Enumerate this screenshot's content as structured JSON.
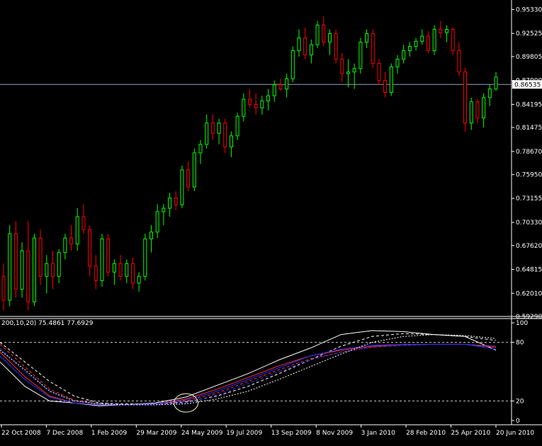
{
  "indicator_label": "200,10,20) 75.4861 77.6929",
  "chart_data": [
    {
      "type": "candlestick",
      "title": "",
      "background": "#000000",
      "up_color": "#00ff00",
      "down_color": "#ff0000",
      "ylim": [
        0.5929,
        0.9645
      ],
      "y_ticks": [
        "0.95330",
        "0.92525",
        "0.89805",
        "0.87000",
        "0.84195",
        "0.81475",
        "0.78670",
        "0.75950",
        "0.73155",
        "0.70330",
        "0.67620",
        "0.64815",
        "0.62010",
        "0.59290"
      ],
      "current_price": 0.86535,
      "current_price_label": "0.86535",
      "candles": [
        [
          0.64,
          0.655,
          0.6,
          0.612
        ],
        [
          0.612,
          0.7,
          0.605,
          0.69
        ],
        [
          0.69,
          0.705,
          0.615,
          0.625
        ],
        [
          0.625,
          0.68,
          0.615,
          0.67
        ],
        [
          0.67,
          0.705,
          0.6,
          0.61
        ],
        [
          0.61,
          0.69,
          0.605,
          0.685
        ],
        [
          0.685,
          0.695,
          0.63,
          0.64
        ],
        [
          0.64,
          0.665,
          0.62,
          0.655
        ],
        [
          0.655,
          0.67,
          0.625,
          0.64
        ],
        [
          0.64,
          0.672,
          0.632,
          0.668
        ],
        [
          0.668,
          0.69,
          0.66,
          0.685
        ],
        [
          0.685,
          0.7,
          0.67,
          0.678
        ],
        [
          0.678,
          0.72,
          0.67,
          0.71
        ],
        [
          0.71,
          0.725,
          0.69,
          0.695
        ],
        [
          0.695,
          0.7,
          0.64,
          0.652
        ],
        [
          0.652,
          0.665,
          0.625,
          0.635
        ],
        [
          0.635,
          0.69,
          0.628,
          0.684
        ],
        [
          0.684,
          0.69,
          0.64,
          0.645
        ],
        [
          0.645,
          0.66,
          0.63,
          0.655
        ],
        [
          0.655,
          0.665,
          0.635,
          0.64
        ],
        [
          0.64,
          0.66,
          0.632,
          0.655
        ],
        [
          0.655,
          0.662,
          0.625,
          0.632
        ],
        [
          0.632,
          0.645,
          0.622,
          0.64
        ],
        [
          0.64,
          0.69,
          0.635,
          0.684
        ],
        [
          0.684,
          0.7,
          0.668,
          0.692
        ],
        [
          0.692,
          0.725,
          0.685,
          0.716
        ],
        [
          0.716,
          0.725,
          0.7,
          0.72
        ],
        [
          0.72,
          0.738,
          0.71,
          0.732
        ],
        [
          0.732,
          0.74,
          0.718,
          0.724
        ],
        [
          0.724,
          0.77,
          0.72,
          0.765
        ],
        [
          0.765,
          0.775,
          0.74,
          0.745
        ],
        [
          0.745,
          0.79,
          0.74,
          0.785
        ],
        [
          0.785,
          0.8,
          0.772,
          0.795
        ],
        [
          0.795,
          0.83,
          0.79,
          0.82
        ],
        [
          0.82,
          0.83,
          0.8,
          0.808
        ],
        [
          0.808,
          0.825,
          0.795,
          0.82
        ],
        [
          0.82,
          0.825,
          0.785,
          0.792
        ],
        [
          0.792,
          0.81,
          0.78,
          0.805
        ],
        [
          0.805,
          0.832,
          0.8,
          0.828
        ],
        [
          0.828,
          0.855,
          0.822,
          0.848
        ],
        [
          0.848,
          0.86,
          0.838,
          0.842
        ],
        [
          0.842,
          0.855,
          0.83,
          0.838
        ],
        [
          0.838,
          0.852,
          0.83,
          0.846
        ],
        [
          0.846,
          0.86,
          0.835,
          0.852
        ],
        [
          0.852,
          0.87,
          0.845,
          0.865
        ],
        [
          0.865,
          0.872,
          0.858,
          0.86
        ],
        [
          0.86,
          0.878,
          0.85,
          0.872
        ],
        [
          0.872,
          0.91,
          0.868,
          0.905
        ],
        [
          0.905,
          0.93,
          0.898,
          0.92
        ],
        [
          0.92,
          0.932,
          0.895,
          0.9
        ],
        [
          0.9,
          0.918,
          0.89,
          0.912
        ],
        [
          0.912,
          0.94,
          0.908,
          0.935
        ],
        [
          0.935,
          0.945,
          0.91,
          0.915
        ],
        [
          0.915,
          0.93,
          0.9,
          0.925
        ],
        [
          0.925,
          0.93,
          0.89,
          0.895
        ],
        [
          0.895,
          0.902,
          0.868,
          0.878
        ],
        [
          0.878,
          0.895,
          0.862,
          0.88
        ],
        [
          0.88,
          0.89,
          0.86,
          0.884
        ],
        [
          0.884,
          0.92,
          0.878,
          0.915
        ],
        [
          0.915,
          0.93,
          0.908,
          0.925
        ],
        [
          0.925,
          0.93,
          0.885,
          0.89
        ],
        [
          0.89,
          0.895,
          0.865,
          0.87
        ],
        [
          0.87,
          0.88,
          0.85,
          0.856
        ],
        [
          0.856,
          0.89,
          0.852,
          0.886
        ],
        [
          0.886,
          0.9,
          0.878,
          0.895
        ],
        [
          0.895,
          0.912,
          0.89,
          0.905
        ],
        [
          0.905,
          0.915,
          0.898,
          0.91
        ],
        [
          0.91,
          0.92,
          0.905,
          0.916
        ],
        [
          0.916,
          0.93,
          0.912,
          0.922
        ],
        [
          0.922,
          0.928,
          0.902,
          0.905
        ],
        [
          0.905,
          0.935,
          0.9,
          0.93
        ],
        [
          0.93,
          0.94,
          0.92,
          0.926
        ],
        [
          0.926,
          0.935,
          0.915,
          0.93
        ],
        [
          0.93,
          0.932,
          0.9,
          0.905
        ],
        [
          0.905,
          0.915,
          0.875,
          0.88
        ],
        [
          0.88,
          0.885,
          0.81,
          0.82
        ],
        [
          0.82,
          0.85,
          0.812,
          0.845
        ],
        [
          0.845,
          0.848,
          0.82,
          0.826
        ],
        [
          0.826,
          0.855,
          0.815,
          0.85
        ],
        [
          0.85,
          0.865,
          0.84,
          0.86
        ],
        [
          0.86,
          0.88,
          0.858,
          0.874
        ]
      ]
    },
    {
      "type": "line",
      "title": "",
      "ylim": [
        0,
        100
      ],
      "y_ticks": [
        "100",
        "80",
        "20",
        "0"
      ],
      "guide_levels": [
        80,
        20
      ],
      "x_labels": [
        "22 Oct 2008",
        "7 Dec 2008",
        "1 Feb 2009",
        "29 Mar 2009",
        "24 May 2009",
        "19 Jul 2009",
        "13 Sep 2009",
        "8 Nov 2009",
        "3 Jan 2010",
        "28 Feb 2010",
        "25 Apr 2010",
        "20 Jun 2010"
      ],
      "marker": {
        "type": "ellipse",
        "x": 30,
        "y": 18
      },
      "series": [
        {
          "color": "#ffffff",
          "style": "solid",
          "x": [
            0,
            4,
            8,
            12,
            16,
            20,
            25,
            30,
            35,
            40,
            45,
            50,
            55,
            60,
            65,
            70,
            75,
            80
          ],
          "y": [
            60,
            35,
            20,
            18,
            15,
            16,
            18,
            24,
            36,
            48,
            62,
            74,
            88,
            92,
            91,
            88,
            86,
            72
          ]
        },
        {
          "color": "#ffffff",
          "style": "dashed",
          "x": [
            0,
            4,
            8,
            12,
            16,
            20,
            25,
            30,
            35,
            40,
            45,
            50,
            55,
            60,
            65,
            70,
            75,
            80
          ],
          "y": [
            80,
            60,
            40,
            25,
            18,
            17,
            17,
            19,
            25,
            35,
            48,
            62,
            76,
            86,
            89,
            88,
            86,
            82
          ]
        },
        {
          "color": "#ff3333",
          "style": "solid",
          "x": [
            0,
            4,
            8,
            12,
            16,
            20,
            25,
            30,
            35,
            40,
            45,
            50,
            55,
            60,
            65,
            70,
            75,
            80
          ],
          "y": [
            70,
            45,
            25,
            18,
            16,
            16,
            17,
            22,
            32,
            44,
            56,
            66,
            72,
            76,
            78,
            78,
            78,
            75
          ]
        },
        {
          "color": "#ff3333",
          "style": "dashed",
          "x": [
            0,
            4,
            8,
            12,
            16,
            20,
            25,
            30,
            35,
            40,
            45,
            50,
            55,
            60,
            65,
            70,
            75,
            80
          ],
          "y": [
            78,
            55,
            32,
            21,
            17,
            16,
            17,
            20,
            28,
            40,
            52,
            63,
            70,
            75,
            77,
            78,
            78,
            76
          ]
        },
        {
          "color": "#2233ff",
          "style": "solid",
          "x": [
            0,
            4,
            8,
            12,
            16,
            20,
            25,
            30,
            35,
            40,
            45,
            50,
            55,
            60,
            65,
            70,
            75,
            80
          ],
          "y": [
            66,
            42,
            24,
            18,
            16,
            16,
            17,
            21,
            30,
            42,
            54,
            66,
            73,
            77,
            78,
            78,
            78,
            73
          ]
        },
        {
          "color": "#2233ff",
          "style": "dashed",
          "x": [
            0,
            4,
            8,
            12,
            16,
            20,
            25,
            30,
            35,
            40,
            45,
            50,
            55,
            60,
            65,
            70,
            75,
            80
          ],
          "y": [
            74,
            50,
            30,
            20,
            17,
            16,
            16,
            18,
            26,
            38,
            50,
            62,
            70,
            75,
            77,
            78,
            78,
            76
          ]
        },
        {
          "color": "#ffffff",
          "style": "dotted",
          "x": [
            0,
            4,
            8,
            12,
            16,
            20,
            25,
            30,
            35,
            40,
            45,
            50,
            55,
            60,
            65,
            70,
            75,
            80
          ],
          "y": [
            72,
            52,
            30,
            20,
            17,
            16,
            16,
            17,
            22,
            30,
            42,
            55,
            68,
            80,
            86,
            88,
            87,
            84
          ]
        }
      ]
    }
  ]
}
